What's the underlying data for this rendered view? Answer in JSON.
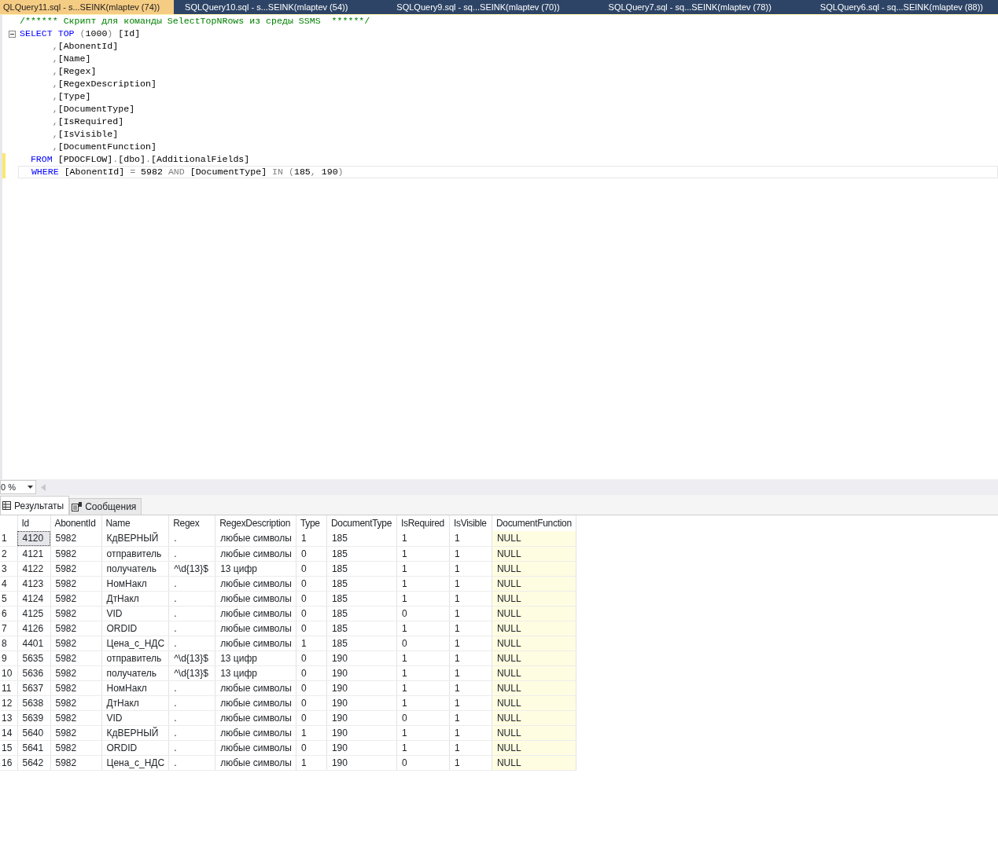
{
  "doc_tabs": [
    {
      "label": "QLQuery11.sql - s...SEINK(mlaptev (74))",
      "selected": true
    },
    {
      "label": "SQLQuery10.sql - s...SEINK(mlaptev (54))",
      "selected": false
    },
    {
      "label": "SQLQuery9.sql - sq...SEINK(mlaptev (70))",
      "selected": false
    },
    {
      "label": "SQLQuery7.sql - sq...SEINK(mlaptev (78))",
      "selected": false
    },
    {
      "label": "SQLQuery6.sql - sq...SEINK(mlaptev (88))",
      "selected": false
    }
  ],
  "editor": {
    "lines": [
      {
        "changed": false,
        "collapsible": false,
        "current": false,
        "tokens": [
          {
            "kind": "comment",
            "text": "/****** Скрипт для команды SelectTopNRows из среды SSMS  ******/"
          }
        ]
      },
      {
        "changed": false,
        "collapsible": true,
        "current": false,
        "tokens": [
          {
            "kind": "keyword",
            "text": "SELECT"
          },
          {
            "kind": "keyword",
            "text": " TOP"
          },
          {
            "kind": "punct",
            "text": " ("
          },
          {
            "kind": "plain",
            "text": "1000"
          },
          {
            "kind": "punct",
            "text": ")"
          },
          {
            "kind": "plain",
            "text": " [Id]"
          }
        ]
      },
      {
        "changed": false,
        "collapsible": false,
        "current": false,
        "tokens": [
          {
            "kind": "punct",
            "text": "      ,"
          },
          {
            "kind": "plain",
            "text": "[AbonentId]"
          }
        ]
      },
      {
        "changed": false,
        "collapsible": false,
        "current": false,
        "tokens": [
          {
            "kind": "punct",
            "text": "      ,"
          },
          {
            "kind": "plain",
            "text": "[Name]"
          }
        ]
      },
      {
        "changed": false,
        "collapsible": false,
        "current": false,
        "tokens": [
          {
            "kind": "punct",
            "text": "      ,"
          },
          {
            "kind": "plain",
            "text": "[Regex]"
          }
        ]
      },
      {
        "changed": false,
        "collapsible": false,
        "current": false,
        "tokens": [
          {
            "kind": "punct",
            "text": "      ,"
          },
          {
            "kind": "plain",
            "text": "[RegexDescription]"
          }
        ]
      },
      {
        "changed": false,
        "collapsible": false,
        "current": false,
        "tokens": [
          {
            "kind": "punct",
            "text": "      ,"
          },
          {
            "kind": "plain",
            "text": "[Type]"
          }
        ]
      },
      {
        "changed": false,
        "collapsible": false,
        "current": false,
        "tokens": [
          {
            "kind": "punct",
            "text": "      ,"
          },
          {
            "kind": "plain",
            "text": "[DocumentType]"
          }
        ]
      },
      {
        "changed": false,
        "collapsible": false,
        "current": false,
        "tokens": [
          {
            "kind": "punct",
            "text": "      ,"
          },
          {
            "kind": "plain",
            "text": "[IsRequired]"
          }
        ]
      },
      {
        "changed": false,
        "collapsible": false,
        "current": false,
        "tokens": [
          {
            "kind": "punct",
            "text": "      ,"
          },
          {
            "kind": "plain",
            "text": "[IsVisible]"
          }
        ]
      },
      {
        "changed": false,
        "collapsible": false,
        "current": false,
        "tokens": [
          {
            "kind": "punct",
            "text": "      ,"
          },
          {
            "kind": "plain",
            "text": "[DocumentFunction]"
          }
        ]
      },
      {
        "changed": true,
        "collapsible": false,
        "current": false,
        "tokens": [
          {
            "kind": "keyword",
            "text": "  FROM"
          },
          {
            "kind": "plain",
            "text": " [PDOCFLOW]"
          },
          {
            "kind": "punct",
            "text": "."
          },
          {
            "kind": "plain",
            "text": "[dbo]"
          },
          {
            "kind": "punct",
            "text": "."
          },
          {
            "kind": "plain",
            "text": "[AdditionalFields]"
          }
        ]
      },
      {
        "changed": true,
        "collapsible": false,
        "current": true,
        "tokens": [
          {
            "kind": "keyword",
            "text": "  WHERE"
          },
          {
            "kind": "plain",
            "text": " [AbonentId] "
          },
          {
            "kind": "punct",
            "text": "="
          },
          {
            "kind": "plain",
            "text": " 5982 "
          },
          {
            "kind": "punct",
            "text": "AND"
          },
          {
            "kind": "plain",
            "text": " [DocumentType] "
          },
          {
            "kind": "punct",
            "text": "IN ("
          },
          {
            "kind": "plain",
            "text": "185"
          },
          {
            "kind": "punct",
            "text": ", "
          },
          {
            "kind": "plain",
            "text": "190"
          },
          {
            "kind": "punct",
            "text": ")"
          }
        ]
      }
    ]
  },
  "zoom": {
    "value": "0 %"
  },
  "result_tabs": [
    {
      "label": "Результаты",
      "selected": true,
      "kind": "grid"
    },
    {
      "label": "Сообщения",
      "selected": false,
      "kind": "messages"
    }
  ],
  "grid": {
    "columns": [
      "Id",
      "AbonentId",
      "Name",
      "Regex",
      "RegexDescription",
      "Type",
      "DocumentType",
      "IsRequired",
      "IsVisible",
      "DocumentFunction"
    ],
    "rows": [
      {
        "number": "1",
        "selected": true,
        "cells": [
          "4120",
          "5982",
          "КдВЕРНЫЙ",
          ".",
          "любые символы",
          "1",
          "185",
          "1",
          "1",
          "NULL"
        ]
      },
      {
        "number": "2",
        "selected": false,
        "cells": [
          "4121",
          "5982",
          "отправитель",
          ".",
          "любые символы",
          "0",
          "185",
          "1",
          "1",
          "NULL"
        ]
      },
      {
        "number": "3",
        "selected": false,
        "cells": [
          "4122",
          "5982",
          "получатель",
          "^\\d{13}$",
          "13 цифр",
          "0",
          "185",
          "1",
          "1",
          "NULL"
        ]
      },
      {
        "number": "4",
        "selected": false,
        "cells": [
          "4123",
          "5982",
          "НомНакл",
          ".",
          "любые символы",
          "0",
          "185",
          "1",
          "1",
          "NULL"
        ]
      },
      {
        "number": "5",
        "selected": false,
        "cells": [
          "4124",
          "5982",
          "ДтНакл",
          ".",
          "любые символы",
          "0",
          "185",
          "1",
          "1",
          "NULL"
        ]
      },
      {
        "number": "6",
        "selected": false,
        "cells": [
          "4125",
          "5982",
          "VID",
          ".",
          "любые символы",
          "0",
          "185",
          "0",
          "1",
          "NULL"
        ]
      },
      {
        "number": "7",
        "selected": false,
        "cells": [
          "4126",
          "5982",
          "ORDID",
          ".",
          "любые символы",
          "0",
          "185",
          "1",
          "1",
          "NULL"
        ]
      },
      {
        "number": "8",
        "selected": false,
        "cells": [
          "4401",
          "5982",
          "Цена_с_НДС",
          ".",
          "любые символы",
          "1",
          "185",
          "0",
          "1",
          "NULL"
        ]
      },
      {
        "number": "9",
        "selected": false,
        "cells": [
          "5635",
          "5982",
          "отправитель",
          "^\\d{13}$",
          "13 цифр",
          "0",
          "190",
          "1",
          "1",
          "NULL"
        ]
      },
      {
        "number": "10",
        "selected": false,
        "cells": [
          "5636",
          "5982",
          "получатель",
          "^\\d{13}$",
          "13 цифр",
          "0",
          "190",
          "1",
          "1",
          "NULL"
        ]
      },
      {
        "number": "11",
        "selected": false,
        "cells": [
          "5637",
          "5982",
          "НомНакл",
          ".",
          "любые символы",
          "0",
          "190",
          "1",
          "1",
          "NULL"
        ]
      },
      {
        "number": "12",
        "selected": false,
        "cells": [
          "5638",
          "5982",
          "ДтНакл",
          ".",
          "любые символы",
          "0",
          "190",
          "1",
          "1",
          "NULL"
        ]
      },
      {
        "number": "13",
        "selected": false,
        "cells": [
          "5639",
          "5982",
          "VID",
          ".",
          "любые символы",
          "0",
          "190",
          "0",
          "1",
          "NULL"
        ]
      },
      {
        "number": "14",
        "selected": false,
        "cells": [
          "5640",
          "5982",
          "КдВЕРНЫЙ",
          ".",
          "любые символы",
          "1",
          "190",
          "1",
          "1",
          "NULL"
        ]
      },
      {
        "number": "15",
        "selected": false,
        "cells": [
          "5641",
          "5982",
          "ORDID",
          ".",
          "любые символы",
          "0",
          "190",
          "1",
          "1",
          "NULL"
        ]
      },
      {
        "number": "16",
        "selected": false,
        "cells": [
          "5642",
          "5982",
          "Цена_с_НДС",
          ".",
          "любые символы",
          "1",
          "190",
          "0",
          "1",
          "NULL"
        ]
      }
    ]
  }
}
